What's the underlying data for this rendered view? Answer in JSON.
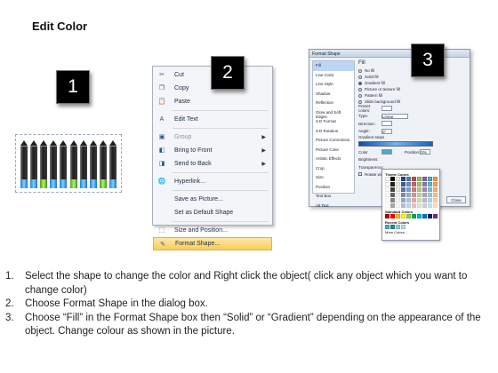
{
  "title": "Edit Color",
  "steps": [
    "1",
    "2",
    "3"
  ],
  "crayons": [
    "blue",
    "blue",
    "green",
    "blue",
    "blue",
    "green",
    "blue",
    "blue",
    "green",
    "blue"
  ],
  "context_menu": {
    "items": [
      {
        "label": "Cut",
        "icon": "scissors-icon",
        "glyph": "✂",
        "disabled": false,
        "submenu": false
      },
      {
        "label": "Copy",
        "icon": "copy-icon",
        "glyph": "❐",
        "disabled": false,
        "submenu": false
      },
      {
        "label": "Paste",
        "icon": "paste-icon",
        "glyph": "📋",
        "disabled": false,
        "submenu": false
      },
      {
        "label": "Edit Text",
        "icon": "edit-text-icon",
        "glyph": "A",
        "disabled": false,
        "submenu": false
      },
      {
        "label": "Group",
        "icon": "group-icon",
        "glyph": "▣",
        "disabled": true,
        "submenu": true
      },
      {
        "label": "Bring to Front",
        "icon": "bring-to-front-icon",
        "glyph": "◧",
        "disabled": false,
        "submenu": true
      },
      {
        "label": "Send to Back",
        "icon": "send-to-back-icon",
        "glyph": "◨",
        "disabled": false,
        "submenu": true
      },
      {
        "label": "Hyperlink...",
        "icon": "hyperlink-icon",
        "glyph": "🌐",
        "disabled": false,
        "submenu": false
      },
      {
        "label": "Save as Picture...",
        "icon": "",
        "glyph": "",
        "disabled": false,
        "submenu": false
      },
      {
        "label": "Set as Default Shape",
        "icon": "",
        "glyph": "",
        "disabled": false,
        "submenu": false
      },
      {
        "label": "Size and Position...",
        "icon": "size-icon",
        "glyph": "⬚",
        "disabled": false,
        "submenu": false
      },
      {
        "label": "Format Shape...",
        "icon": "format-shape-icon",
        "glyph": "✎",
        "disabled": false,
        "submenu": false,
        "selected": true
      }
    ]
  },
  "dialog": {
    "title": "Format Shape",
    "categories": [
      "Fill",
      "Line Color",
      "Line Style",
      "Shadow",
      "Reflection",
      "Glow and Soft Edges",
      "3-D Format",
      "3-D Rotation",
      "Picture Corrections",
      "Picture Color",
      "Artistic Effects",
      "Crop",
      "Size",
      "Position",
      "Text Box",
      "Alt Text"
    ],
    "section": "Fill",
    "options": [
      "No fill",
      "Solid fill",
      "Gradient fill",
      "Picture or texture fill",
      "Pattern fill",
      "Slide background fill"
    ],
    "selected_option": "Gradient fill",
    "fields": [
      "Preset colors:",
      "Type:",
      "Direction:",
      "Angle:",
      "Gradient stops"
    ],
    "type_value": "Linear",
    "angle_value": "0°",
    "color_label": "Color",
    "position_label": "Position:",
    "position_value": "0%",
    "brightness_label": "Brightness:",
    "transparency_label": "Transparency:",
    "rotate_label": "Rotate with shape",
    "close_label": "Close"
  },
  "palette": {
    "theme_label": "Theme Colors",
    "standard_label": "Standard Colors",
    "recent_label": "Recent Colors",
    "more_label": "More Colors...",
    "theme_colors": [
      "#ffffff",
      "#000000",
      "#eeece1",
      "#1f497d",
      "#4f81bd",
      "#c0504d",
      "#9bbb59",
      "#8064a2",
      "#4bacc6",
      "#f79646"
    ],
    "standard_colors": [
      "#c00000",
      "#ff0000",
      "#ffc000",
      "#ffff00",
      "#92d050",
      "#00b050",
      "#00b0f0",
      "#0070c0",
      "#002060",
      "#7030a0"
    ],
    "recent_colors": [
      "#4bacc6",
      "#31859c",
      "#92cddc",
      "#b6dde8"
    ]
  },
  "instructions": [
    {
      "n": "1.",
      "text": "Select the shape to change the color and Right click the object( click any object which you want to change color)"
    },
    {
      "n": "2.",
      "text": "Choose Format Shape in the dialog box."
    },
    {
      "n": "3.",
      "text": "Choose “Fill” in the Format Shape box then “Solid” or “Gradient” depending on the appearance of the object. Change colour as shown in the picture."
    }
  ]
}
